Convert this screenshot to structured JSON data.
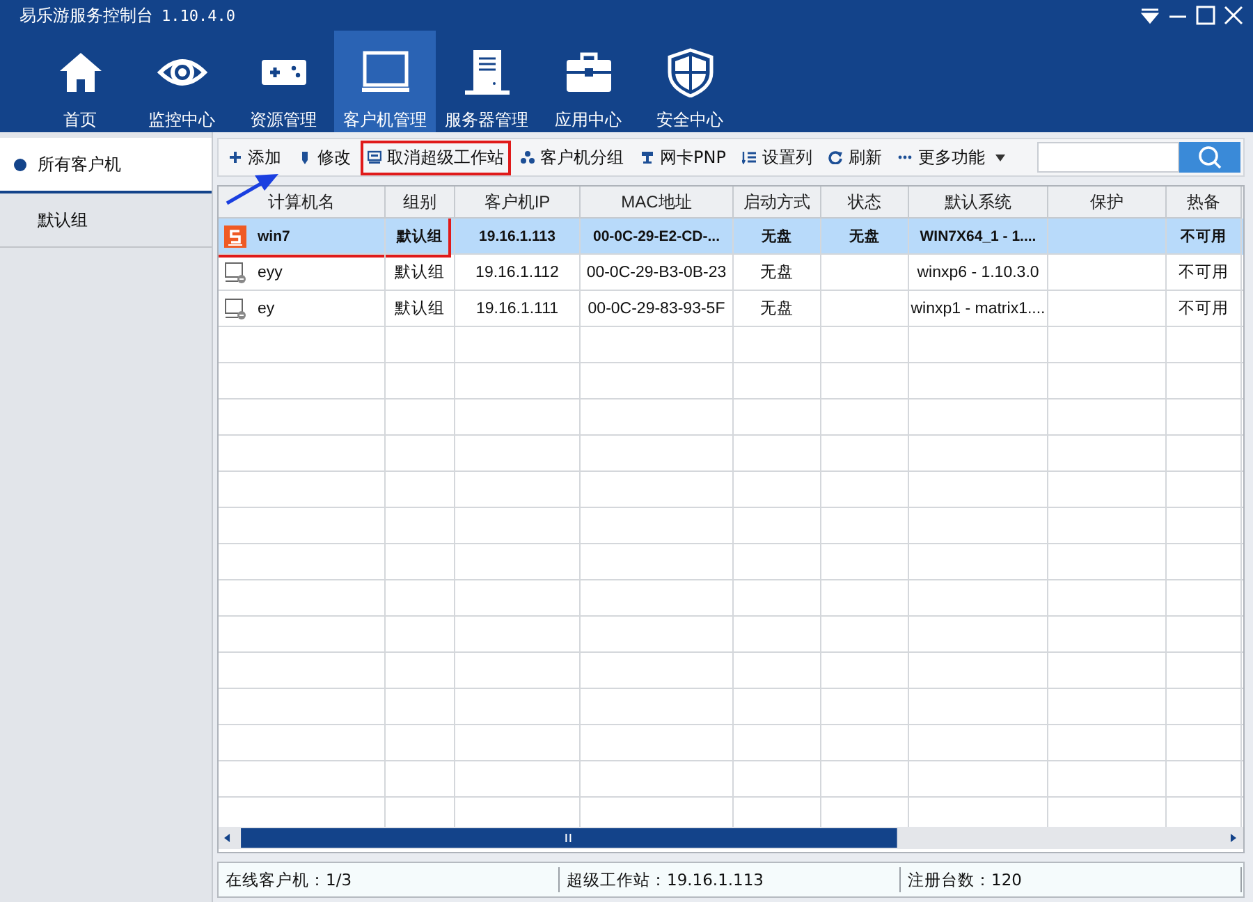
{
  "window": {
    "title": "易乐游服务控制台",
    "version": "1.10.4.0"
  },
  "nav": [
    {
      "kind": "home",
      "label": "首页",
      "selected": false
    },
    {
      "kind": "eye",
      "label": "监控中心",
      "selected": false
    },
    {
      "kind": "gamepad",
      "label": "资源管理",
      "selected": false
    },
    {
      "kind": "monitor",
      "label": "客户机管理",
      "selected": true
    },
    {
      "kind": "server",
      "label": "服务器管理",
      "selected": false
    },
    {
      "kind": "toolbox",
      "label": "应用中心",
      "selected": false
    },
    {
      "kind": "shield",
      "label": "安全中心",
      "selected": false
    }
  ],
  "sidebar": {
    "items": [
      {
        "label": "所有客户机",
        "selected": true
      },
      {
        "label": "默认组",
        "selected": false
      }
    ]
  },
  "toolbar": {
    "items": [
      {
        "kind": "plus",
        "label": "添加",
        "highlighted": false
      },
      {
        "kind": "pen",
        "label": "修改",
        "highlighted": false
      },
      {
        "kind": "card",
        "label": "取消超级工作站",
        "highlighted": true
      },
      {
        "kind": "group",
        "label": "客户机分组",
        "highlighted": false
      },
      {
        "kind": "pnp",
        "label": "网卡PNP",
        "highlighted": false
      },
      {
        "kind": "list",
        "label": "设置列",
        "highlighted": false
      },
      {
        "kind": "refresh",
        "label": "刷新",
        "highlighted": false
      },
      {
        "kind": "more",
        "label": "更多功能",
        "highlighted": false
      }
    ]
  },
  "table": {
    "columns": [
      "计算机名",
      "组别",
      "客户机IP",
      "MAC地址",
      "启动方式",
      "状态",
      "默认系统",
      "保护",
      "热备"
    ],
    "rows": [
      {
        "kind": "super",
        "selected": true,
        "highlighted": true,
        "cells": [
          "win7",
          "默认组",
          "19.16.1.113",
          "00-0C-29-E2-CD-...",
          "无盘",
          "无盘",
          "WIN7X64_1 - 1....",
          "",
          "不可用"
        ]
      },
      {
        "kind": "normal",
        "selected": false,
        "highlighted": false,
        "cells": [
          "eyy",
          "默认组",
          "19.16.1.112",
          "00-0C-29-B3-0B-23",
          "无盘",
          "",
          "winxp6 - 1.10.3.0",
          "",
          "不可用"
        ]
      },
      {
        "kind": "normal",
        "selected": false,
        "highlighted": false,
        "cells": [
          "ey",
          "默认组",
          "19.16.1.111",
          "00-0C-29-83-93-5F",
          "无盘",
          "",
          "winxp1 - matrix1....",
          "",
          "不可用"
        ]
      }
    ]
  },
  "status_bar": [
    "在线客户机：1/3",
    "超级工作站：19.16.1.113",
    "注册台数：120"
  ]
}
